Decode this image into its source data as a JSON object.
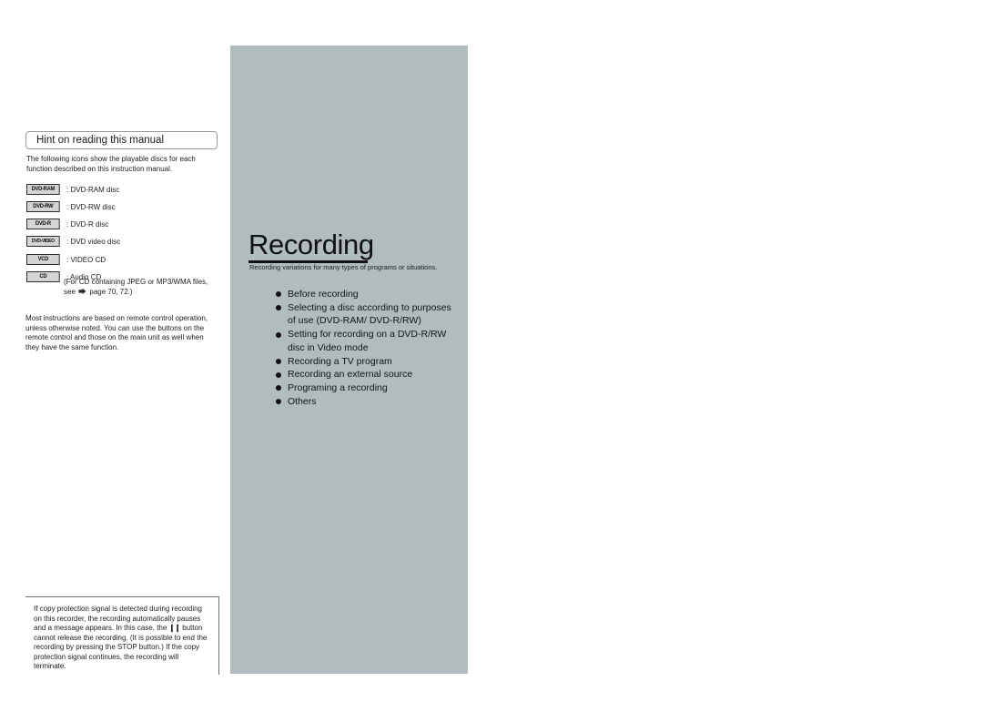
{
  "left_column": {
    "hint_header": "Hint on reading this manual",
    "intro": "The following icons show the playable discs for each function described on this instruction manual.",
    "disc_types": [
      {
        "badge": "DVD-RAM",
        "label": ": DVD-RAM disc"
      },
      {
        "badge": "DVD-RW",
        "label": ": DVD-RW disc"
      },
      {
        "badge": "DVD-R",
        "label": ": DVD-R disc"
      },
      {
        "badge": "DVD-VIDEO",
        "label": ": DVD video disc"
      },
      {
        "badge": "VCD",
        "label": ": VIDEO CD"
      },
      {
        "badge": "CD",
        "label": ": Audio CD"
      }
    ],
    "cd_note_line1": "(For CD containing JPEG or MP3/WMA files,",
    "cd_note_line2_prefix": "see",
    "cd_note_line2_suffix": "page 70, 72.)",
    "page_arrow_icon": "page-pointer-arrow-icon",
    "footnote": "Most instructions are based on remote control operation, unless otherwise noted. You can use the buttons on the remote control and those on the main unit as well when they have the same function.",
    "caution_text_part1": "If copy protection signal is detected during recording on this recorder, the recording automatically pauses and a message appears. In this case, the",
    "caution_pause_glyph": "❙❙",
    "caution_text_part2": "button cannot release the recording. (It is possible to end the recording by pressing the STOP button.) If the copy protection signal continues, the recording will terminate."
  },
  "chapter_panel": {
    "title": "Recording",
    "subtitle": "Recording variations for many types of programs or situations.",
    "items": [
      "Before recording",
      "Selecting a disc according to purposes of use (DVD-RAM/ DVD-R/RW)",
      "Setting for recording on a DVD-R/RW disc in Video mode",
      "Recording a TV program",
      "Recording an external source",
      "Programing a recording",
      "Others"
    ]
  },
  "colors": {
    "panel_background": "#b0bcbd",
    "page_background": "#ffffff",
    "badge_background": "#d4d4d4",
    "text": "#1c1c1c"
  }
}
